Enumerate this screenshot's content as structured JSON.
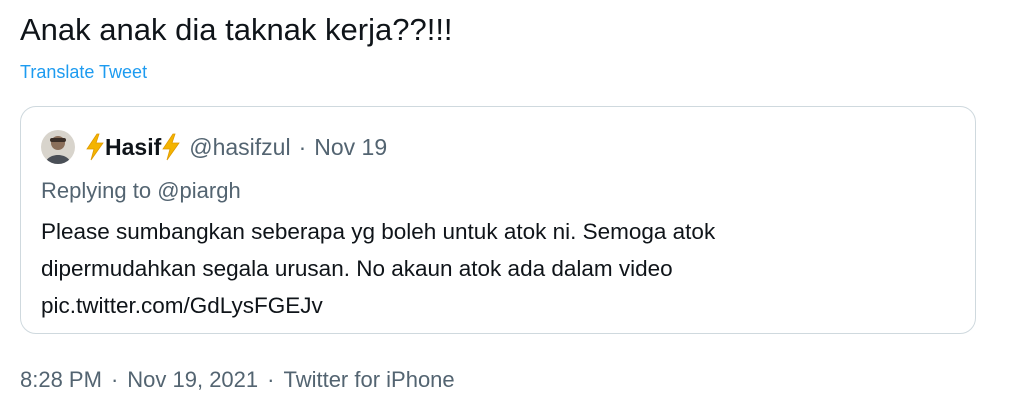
{
  "tweet": {
    "text": "Anak anak dia taknak kerja??!!!",
    "translate_label": "Translate Tweet"
  },
  "quoted_tweet": {
    "display_name": "Hasif",
    "handle": "@hasifzul",
    "separator": "·",
    "date": "Nov 19",
    "replying_prefix": "Replying to ",
    "replying_to": "@piargh",
    "body_lines": [
      "Please sumbangkan seberapa yg boleh untuk atok ni. Semoga atok",
      "dipermudahkan segala urusan. No akaun atok ada dalam video",
      "pic.twitter.com/GdLysFGEJv"
    ]
  },
  "meta": {
    "time": "8:28 PM",
    "separator": "·",
    "date": "Nov 19, 2021",
    "source": "Twitter for iPhone"
  },
  "colors": {
    "link": "#1d9bf0",
    "text": "#0f1419",
    "secondary": "#536471",
    "border": "#cfd9de",
    "bolt": "#f4b400"
  }
}
